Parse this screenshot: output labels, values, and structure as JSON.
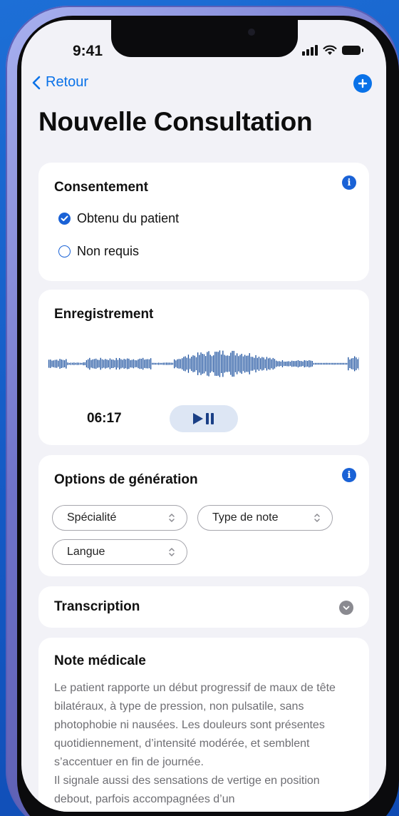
{
  "status_bar": {
    "time": "9:41"
  },
  "nav": {
    "back_label": "Retour"
  },
  "page": {
    "title": "Nouvelle Consultation"
  },
  "consent": {
    "title": "Consentement",
    "options": [
      {
        "label": "Obtenu du patient",
        "selected": true
      },
      {
        "label": "Non requis",
        "selected": false
      }
    ]
  },
  "recording": {
    "title": "Enregistrement",
    "elapsed": "06:17"
  },
  "generation": {
    "title": "Options de génération",
    "selects": {
      "specialty": "Spécialité",
      "note_type": "Type de note",
      "language": "Langue"
    }
  },
  "transcription": {
    "title": "Transcription"
  },
  "note": {
    "title": "Note médicale",
    "paragraph_1": "Le patient rapporte un début progressif de maux de tête bilatéraux, à type de pression, non pulsatile, sans photophobie ni nausées. Les douleurs sont présentes quotidiennement, d’intensité modérée, et semblent s’accentuer en fin de journée.",
    "paragraph_2": "Il signale aussi des sensations de vertige en position debout, parfois accompagnées d’un"
  },
  "colors": {
    "accent": "#0a72e8",
    "background": "#f2f2f7",
    "card": "#ffffff",
    "waveform": "#1a4f9e"
  },
  "icons": {
    "back": "chevron-left-icon",
    "add": "plus-circle-icon",
    "info": "info-circle-icon",
    "play_pause": "play-pause-icon",
    "expand": "chevron-down-circle-icon",
    "select": "up-down-chevron-icon"
  }
}
